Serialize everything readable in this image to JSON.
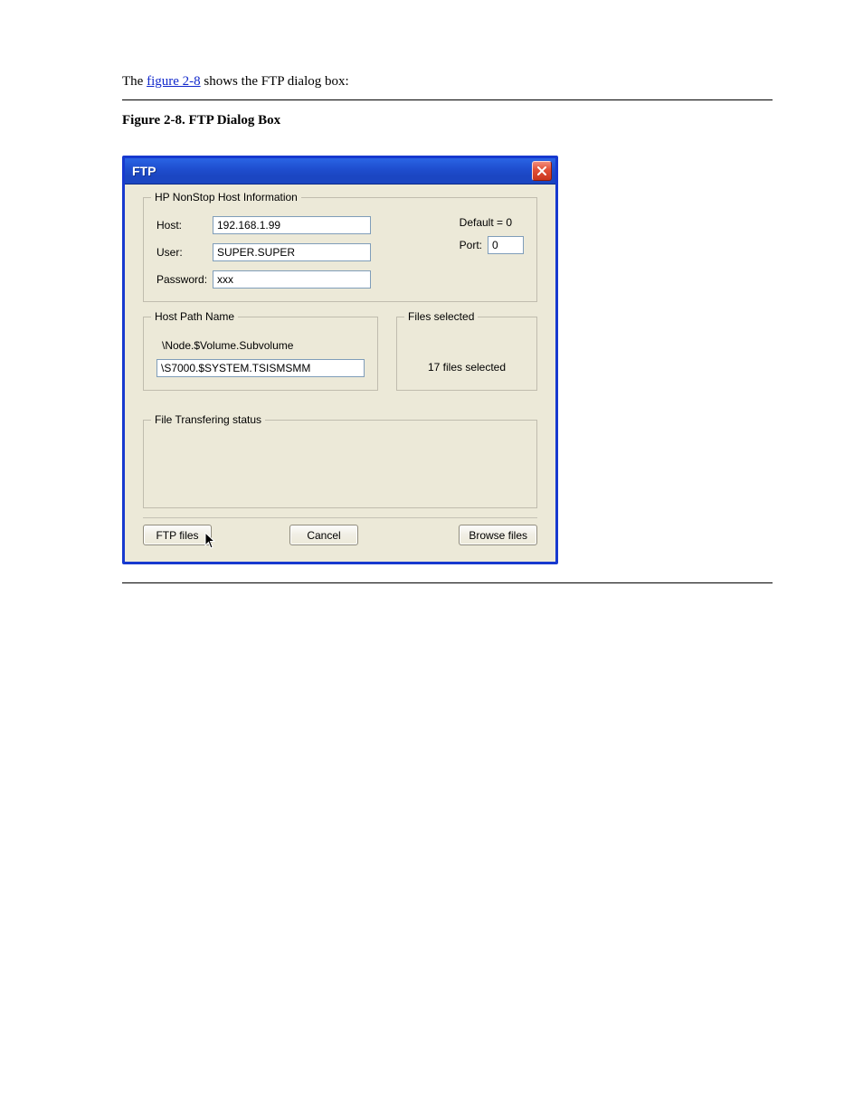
{
  "intro": {
    "prefix": "The ",
    "figref": "figure 2-8",
    "rest": " shows the FTP dialog box:"
  },
  "caption": "Figure 2-8. FTP Dialog Box",
  "dialog": {
    "title": "FTP",
    "groups": {
      "hostinfo": {
        "legend": "HP NonStop Host Information",
        "host_label": "Host:",
        "host_value": "192.168.1.99",
        "user_label": "User:",
        "user_value": "SUPER.SUPER",
        "password_label": "Password:",
        "password_value": "xxx",
        "default_text": "Default = 0",
        "port_label": "Port:",
        "port_value": "0"
      },
      "hostpath": {
        "legend": "Host Path Name",
        "hint": "\\Node.$Volume.Subvolume",
        "value": "\\S7000.$SYSTEM.TSISMSMM"
      },
      "files": {
        "legend": "Files selected",
        "text": "17 files selected"
      },
      "status": {
        "legend": "File Transfering status"
      }
    },
    "buttons": {
      "ftp": "FTP files",
      "cancel": "Cancel",
      "browse": "Browse files"
    }
  }
}
